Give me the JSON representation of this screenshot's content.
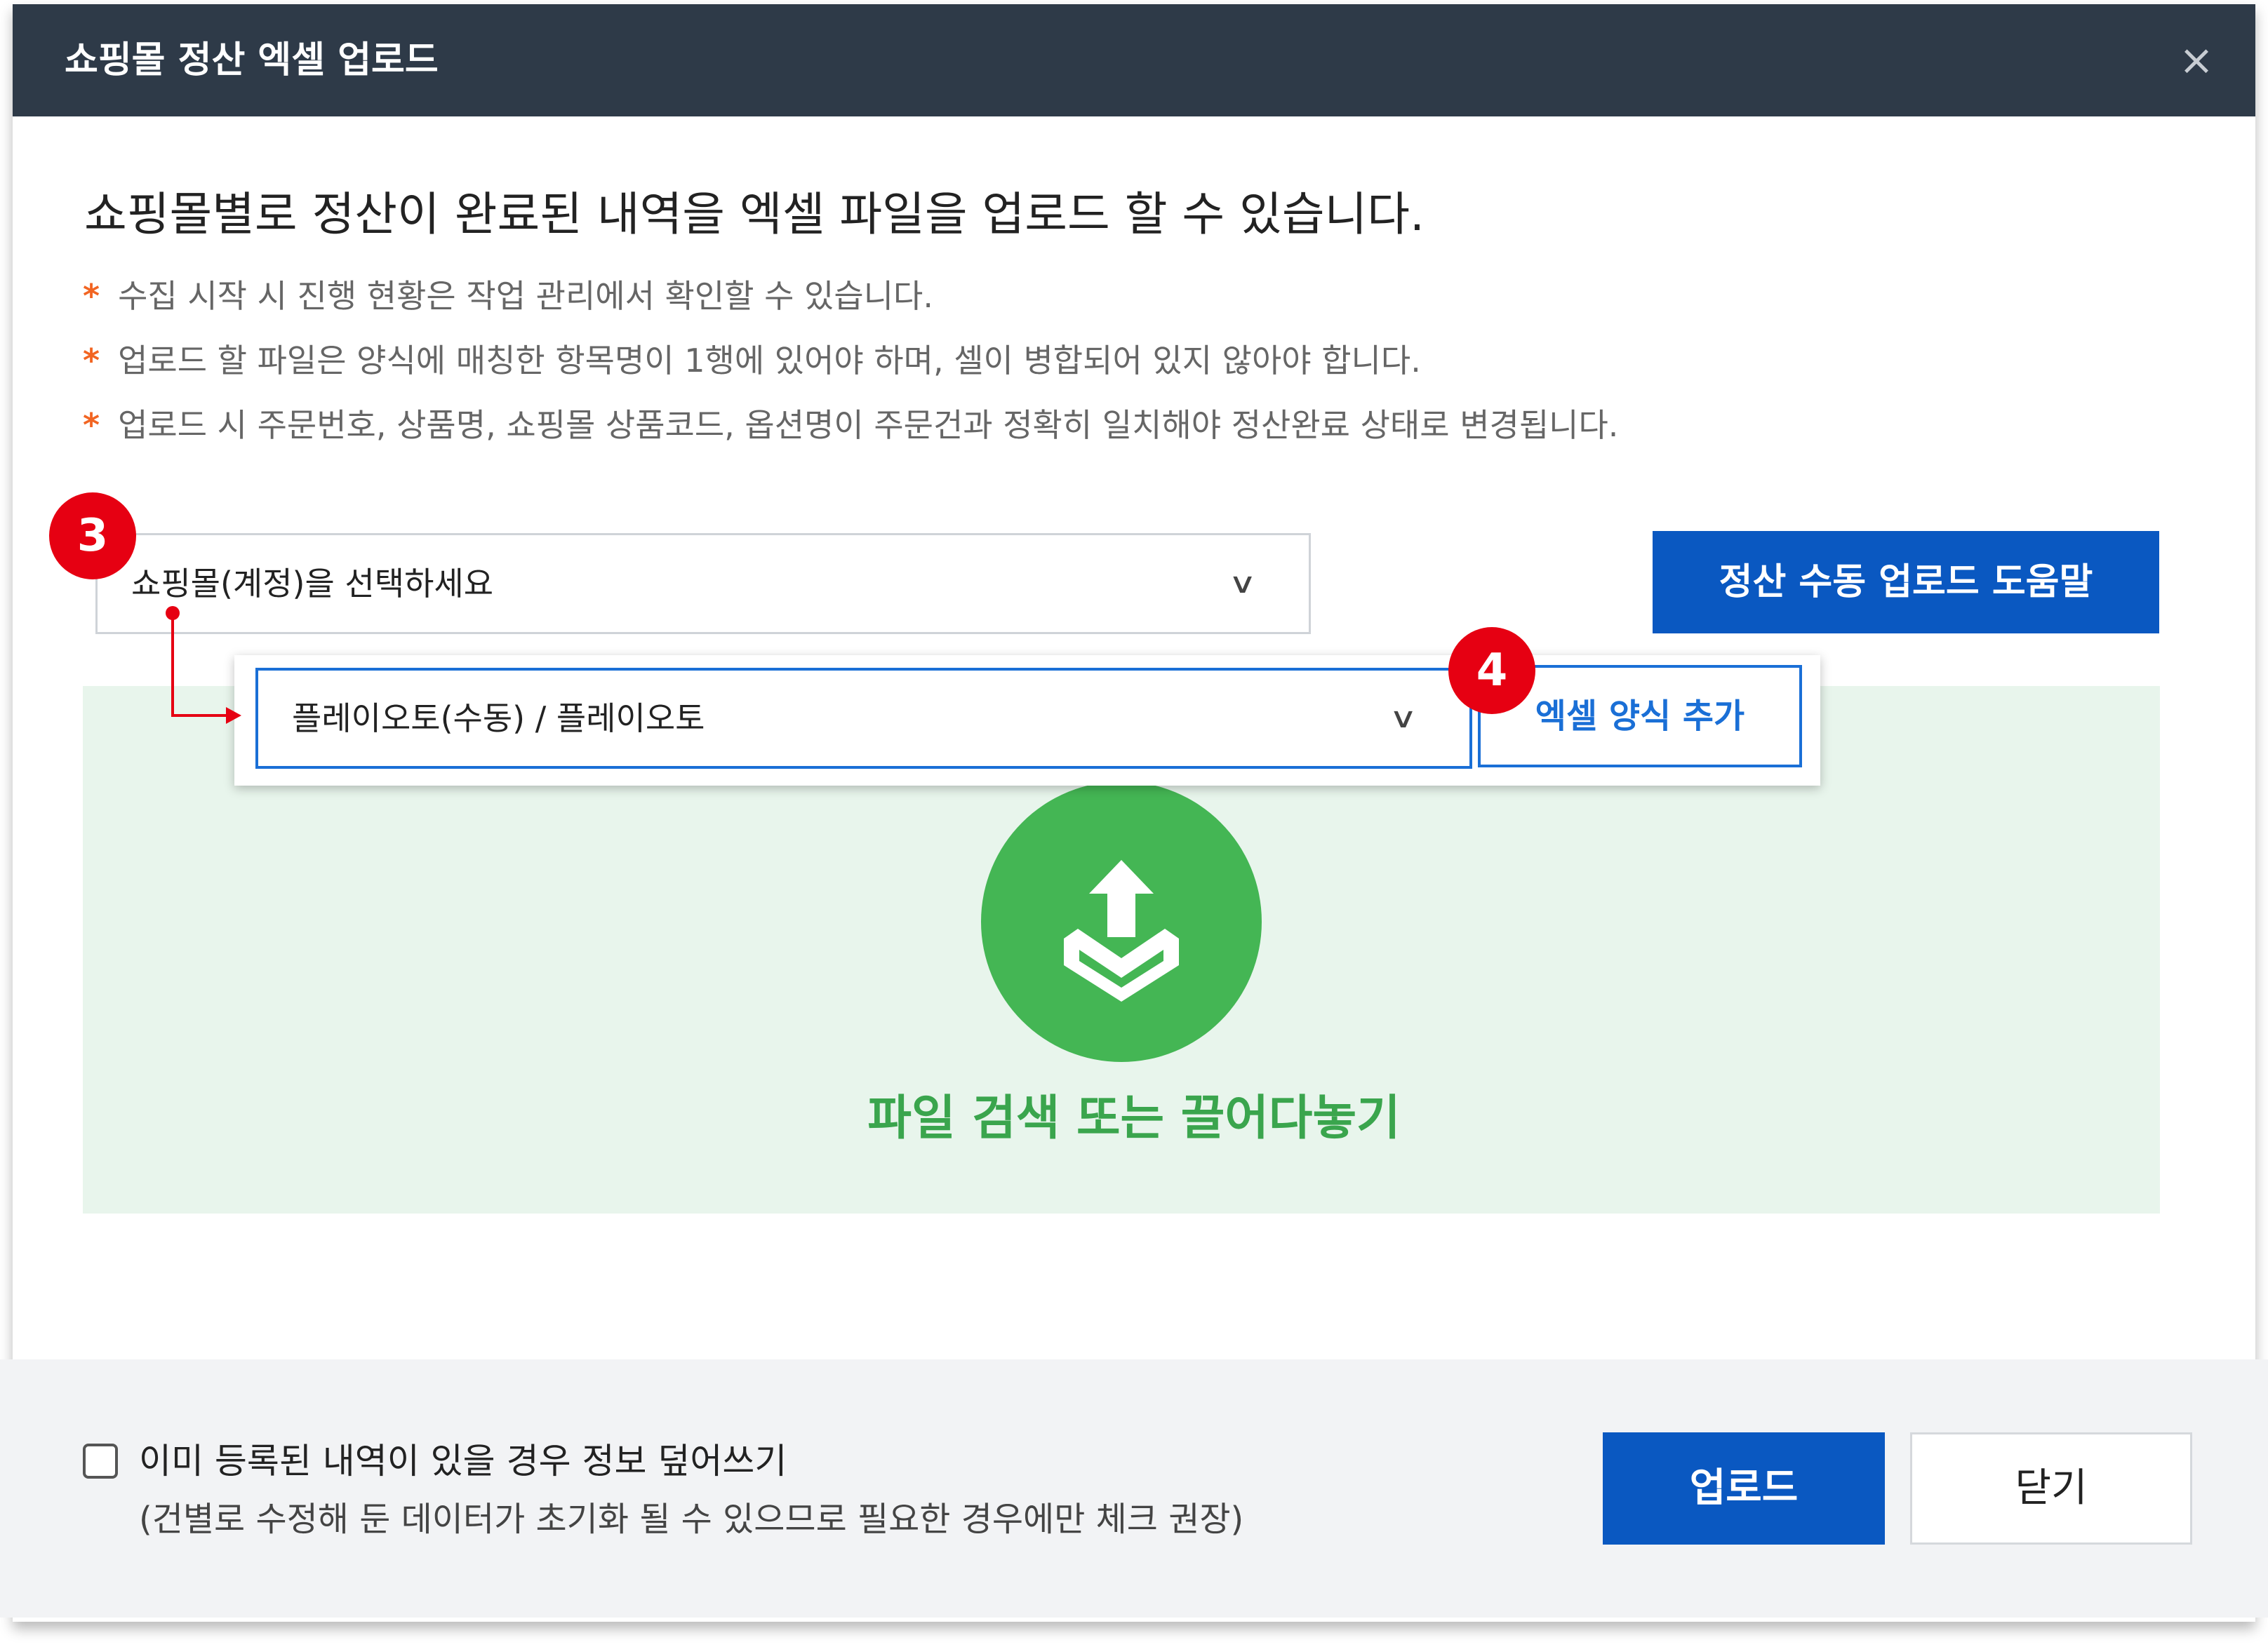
{
  "dialog": {
    "title": "쇼핑몰 정산 엑셀 업로드",
    "close_icon": "×"
  },
  "main": {
    "headline": "쇼핑몰별로 정산이 완료된 내역을 엑셀 파일을 업로드 할 수 있습니다.",
    "notes": [
      "수집 시작 시 진행 현황은 작업 관리에서 확인할 수 있습니다.",
      "업로드 할 파일은 양식에 매칭한 항목명이 1행에 있어야 하며, 셀이 병합되어 있지 않아야 합니다.",
      "업로드 시 주문번호, 상품명, 쇼핑몰 상품코드, 옵션명이 주문건과 정확히 일치해야 정산완료 상태로 변경됩니다."
    ],
    "note_marker": "*",
    "shop_select": {
      "value": "쇼핑몰(계정)을 선택하세요",
      "chevron": "∨"
    },
    "help_button": "정산 수동 업로드 도움말",
    "format_select": {
      "value": "플레이오토(수동) / 플레이오토",
      "chevron": "∨"
    },
    "excel_format_button": "엑셀 양식 추가",
    "dropzone_text": "파일 검색 또는 끌어다놓기",
    "markers": [
      "3",
      "4"
    ]
  },
  "footer": {
    "overwrite_label": "이미 등록된 내역이 있을 경우 정보 덮어쓰기",
    "overwrite_sub": "(건별로 수정해 둔 데이터가 초기화 될 수 있으므로 필요한 경우에만 체크 권장)",
    "overwrite_checked": false,
    "upload_button": "업로드",
    "close_button": "닫기"
  },
  "colors": {
    "titlebar": "#2e3a48",
    "primary": "#0a58c1",
    "dropzone_bg": "#e8f5ec",
    "upload_green": "#44b654",
    "marker_red": "#e60012",
    "note_star": "#f26522"
  },
  "icons": {
    "close": "close-icon",
    "chevron": "chevron-down-icon",
    "upload": "upload-tray-icon",
    "checkbox": "checkbox-icon"
  }
}
